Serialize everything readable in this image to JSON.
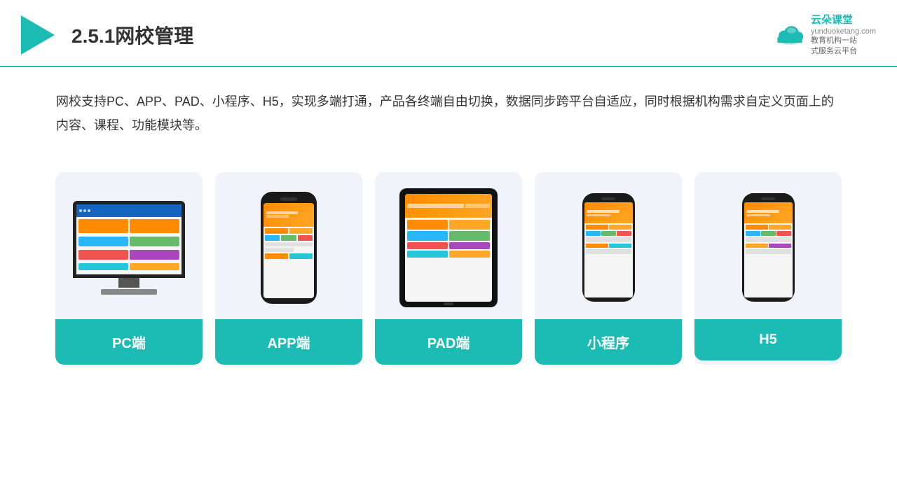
{
  "header": {
    "title": "2.5.1网校管理",
    "brand": {
      "name": "云朵课堂",
      "url": "yunduoketang.com",
      "tagline": "教育机构一站\n式服务云平台"
    }
  },
  "description": {
    "text": "网校支持PC、APP、PAD、小程序、H5，实现多端打通，产品各终端自由切换，数据同步跨平台自适应，同时根据机构需求自定义页面上的内容、课程、功能模块等。"
  },
  "cards": [
    {
      "id": "pc",
      "label": "PC端"
    },
    {
      "id": "app",
      "label": "APP端"
    },
    {
      "id": "pad",
      "label": "PAD端"
    },
    {
      "id": "miniprogram",
      "label": "小程序"
    },
    {
      "id": "h5",
      "label": "H5"
    }
  ],
  "colors": {
    "teal": "#1cbbb4",
    "dark": "#333",
    "cardBg": "#eef2f8"
  }
}
